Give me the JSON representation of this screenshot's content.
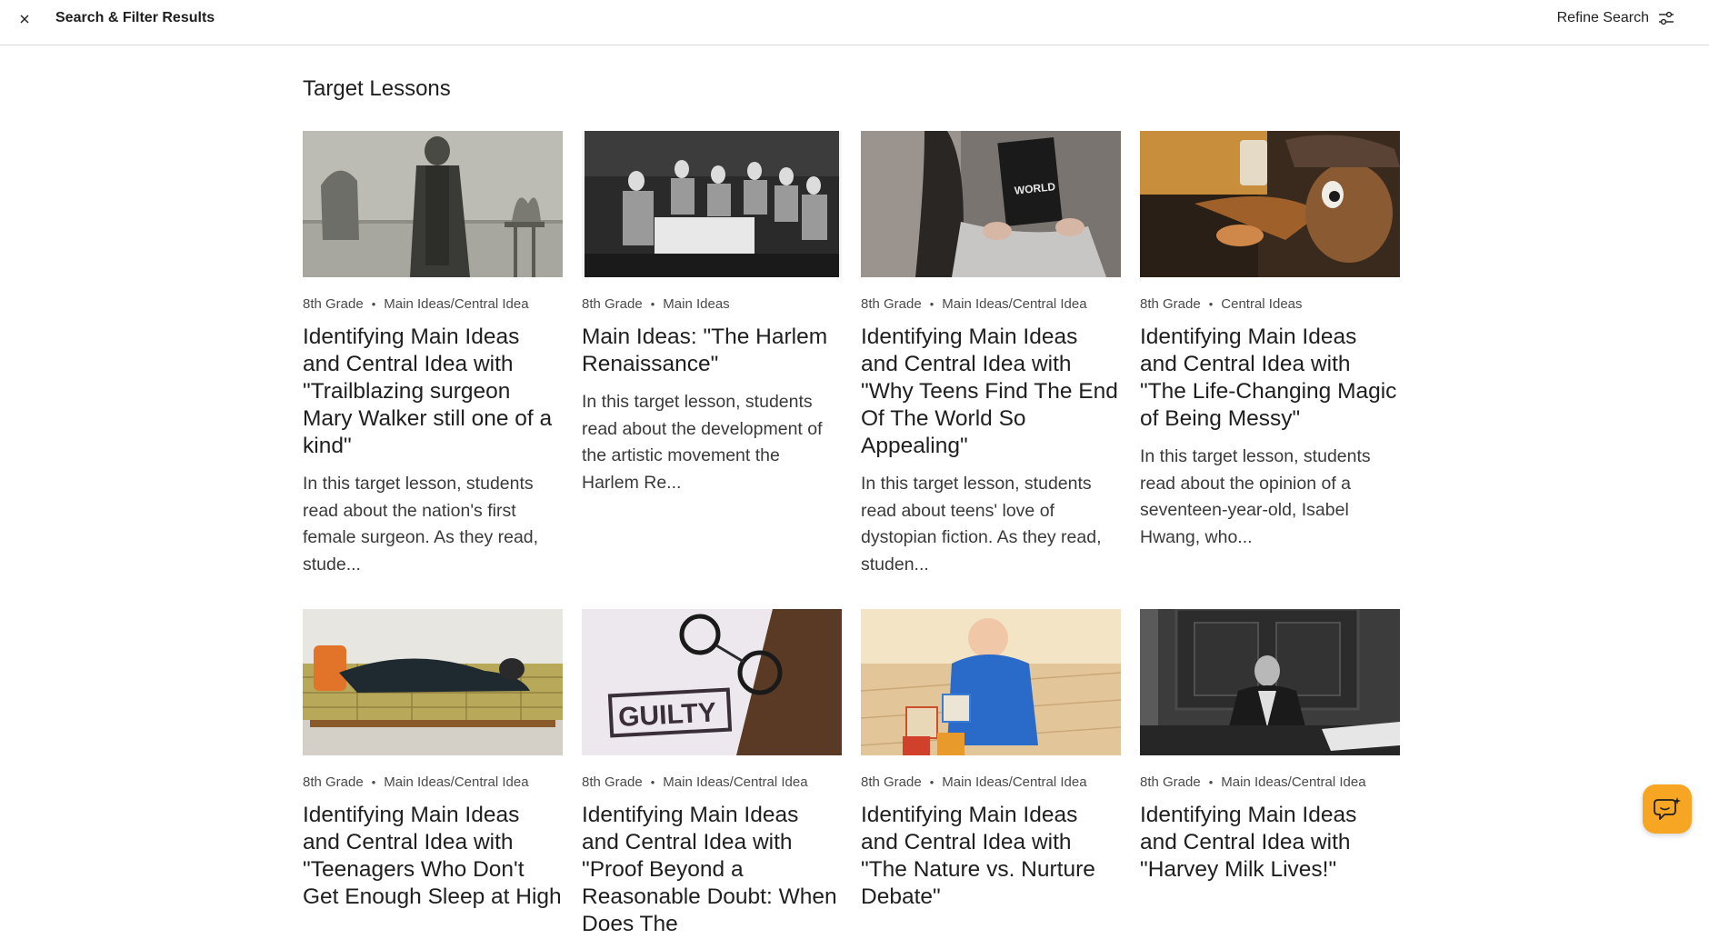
{
  "header": {
    "title": "Search & Filter Results",
    "refine_label": "Refine Search"
  },
  "section": {
    "title": "Target Lessons"
  },
  "cards": [
    {
      "grade": "8th Grade",
      "topic": "Main Ideas/Central Idea",
      "title": "Identifying Main Ideas and Central Idea with \"Trailblazing surgeon Mary Walker still one of a kind\"",
      "description": "In this target lesson, students read about the nation's first female surgeon. As they read, stude...",
      "image": "vintage-photo-woman-in-coat"
    },
    {
      "grade": "8th Grade",
      "topic": "Main Ideas",
      "title": "Main Ideas: \"The Harlem Renaissance\"",
      "description": "In this target lesson, students read about the development of the artistic movement the Harlem Re...",
      "image": "jazz-band-photo"
    },
    {
      "grade": "8th Grade",
      "topic": "Main Ideas/Central Idea",
      "title": "Identifying Main Ideas and Central Idea with \"Why Teens Find The End Of The World So Appealing\"",
      "description": "In this target lesson, students read about teens' love of dystopian fiction. As they read, studen...",
      "image": "teen-reading-book"
    },
    {
      "grade": "8th Grade",
      "topic": "Central Ideas",
      "title": "Identifying Main Ideas and Central Idea with \"The Life-Changing Magic of Being Messy\"",
      "description": "In this target lesson, students read about the opinion of a seventeen-year-old, Isabel Hwang, who...",
      "image": "messy-room-teddy-bear"
    },
    {
      "grade": "8th Grade",
      "topic": "Main Ideas/Central Idea",
      "title": "Identifying Main Ideas and Central Idea with \"Teenagers Who Don't Get Enough Sleep at High",
      "description": "",
      "image": "teen-sleeping-on-couch"
    },
    {
      "grade": "8th Grade",
      "topic": "Main Ideas/Central Idea",
      "title": "Identifying Main Ideas and Central Idea with \"Proof Beyond a Reasonable Doubt: When Does The",
      "description": "",
      "image": "guilty-stamp-handcuffs"
    },
    {
      "grade": "8th Grade",
      "topic": "Main Ideas/Central Idea",
      "title": "Identifying Main Ideas and Central Idea with \"The Nature vs. Nurture Debate\"",
      "description": "",
      "image": "toddler-with-blocks"
    },
    {
      "grade": "8th Grade",
      "topic": "Main Ideas/Central Idea",
      "title": "Identifying Main Ideas and Central Idea with \"Harvey Milk Lives!\"",
      "description": "",
      "image": "man-at-desk-bw"
    }
  ],
  "icons": {
    "close": "close-icon",
    "refine": "sliders-icon",
    "help": "chat-help-icon"
  },
  "colors": {
    "accent": "#f6a623",
    "text": "#1f1f1f",
    "border": "#d9d9d9"
  }
}
